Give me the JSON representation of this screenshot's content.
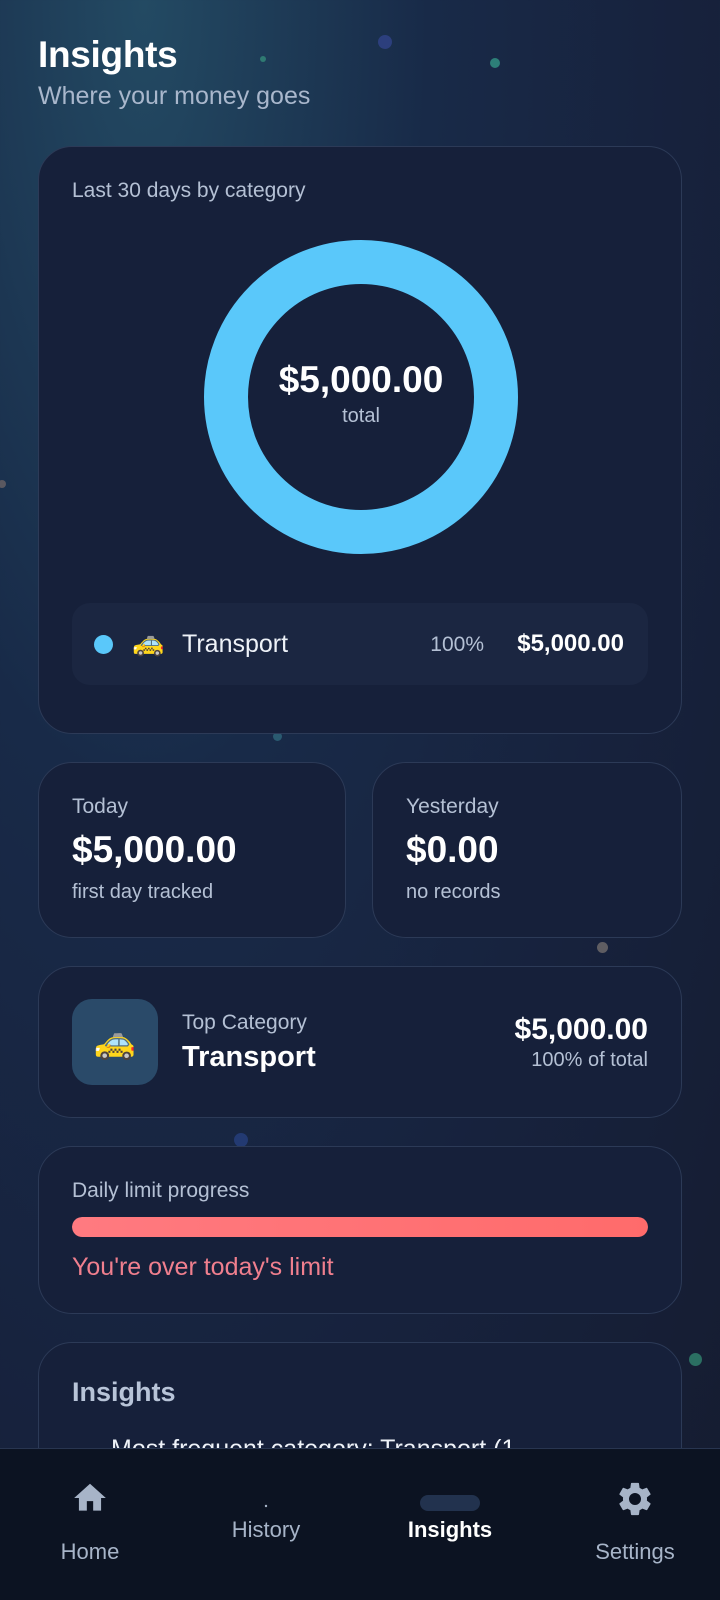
{
  "header": {
    "title": "Insights",
    "subtitle": "Where your money goes"
  },
  "category_card": {
    "label": "Last 30 days by category",
    "total_amount": "$5,000.00",
    "total_label": "total",
    "legend": [
      {
        "color": "#5ac8fa",
        "emoji": "🚕",
        "name": "Transport",
        "percent": "100%",
        "amount": "$5,000.00"
      }
    ]
  },
  "chart_data": {
    "type": "pie",
    "categories": [
      "Transport"
    ],
    "values": [
      5000
    ],
    "colors": [
      "#5ac8fa"
    ]
  },
  "today": {
    "label": "Today",
    "value": "$5,000.00",
    "note": "first day tracked"
  },
  "yesterday": {
    "label": "Yesterday",
    "value": "$0.00",
    "note": "no records"
  },
  "top_category": {
    "icon_emoji": "🚕",
    "label": "Top Category",
    "name": "Transport",
    "amount": "$5,000.00",
    "percent_text": "100% of total"
  },
  "daily_limit": {
    "label": "Daily limit progress",
    "progress_fraction": 1.0,
    "warning": "You're over today's limit"
  },
  "insights_card": {
    "title": "Insights",
    "first_line": "Most frequent category: Transport (1"
  },
  "nav": {
    "items": [
      {
        "label": "Home",
        "icon": "home-icon"
      },
      {
        "label": "History",
        "icon": "history-icon"
      },
      {
        "label": "Insights",
        "icon": "insights-icon",
        "active": true
      },
      {
        "label": "Settings",
        "icon": "gear-icon"
      }
    ]
  },
  "colors": {
    "accent": "#5ac8fa",
    "warning": "#ff6b6b",
    "card_bg": "#16203a"
  }
}
